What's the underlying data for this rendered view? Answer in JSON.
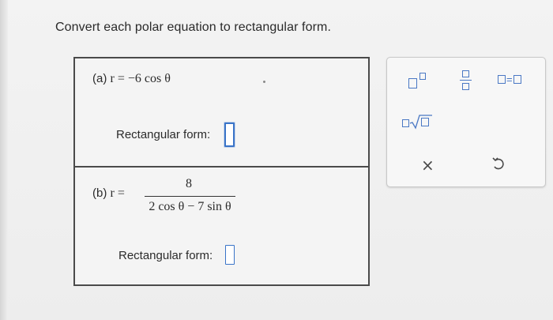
{
  "instruction": "Convert each polar equation to rectangular form.",
  "part_a": {
    "label": "(a)",
    "equation": "r = −6 cos θ",
    "answer_label": "Rectangular form:",
    "answer_value": ""
  },
  "part_b": {
    "label": "(b)",
    "lhs": "r =",
    "numerator": "8",
    "denominator": "2 cos θ − 7 sin θ",
    "answer_label": "Rectangular form:",
    "answer_value": ""
  },
  "toolbar": {
    "mixed_equals": "=",
    "clear_symbol": "×",
    "icons": [
      "exponent-icon",
      "fraction-icon",
      "mixed-number-icon",
      "nth-root-icon",
      "clear-icon",
      "undo-icon"
    ],
    "accent_color": "#4a78c4"
  },
  "colors": {
    "focus_border": "#3a74c8",
    "box_border": "#4a4a4a",
    "background": "#f3f3f3"
  }
}
